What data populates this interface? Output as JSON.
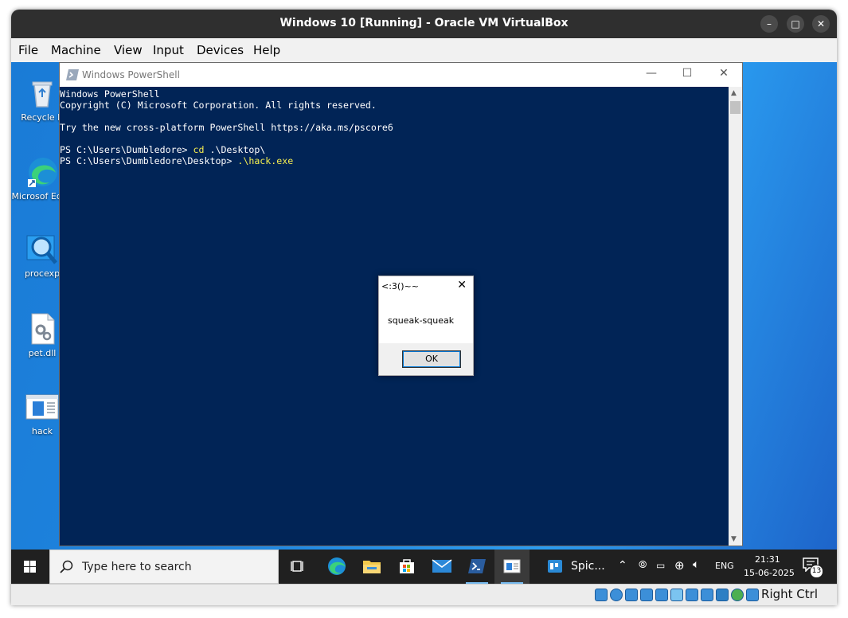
{
  "host_window": {
    "title": "Windows 10 [Running] - Oracle VM VirtualBox",
    "controls": {
      "minimize": "–",
      "maximize": "□",
      "close": "✕"
    },
    "menu": [
      "File",
      "Machine",
      "View",
      "Input",
      "Devices",
      "Help"
    ]
  },
  "desktop": {
    "icons": [
      {
        "label": "Recycle B",
        "icon": "recycle-bin-icon"
      },
      {
        "label": "Microsof Edge",
        "icon": "edge-icon"
      },
      {
        "label": "procexp",
        "icon": "process-explorer-icon"
      },
      {
        "label": "pet.dll",
        "icon": "dll-file-icon"
      },
      {
        "label": "hack",
        "icon": "exe-window-icon"
      }
    ]
  },
  "powershell": {
    "title": "Windows PowerShell",
    "controls": {
      "minimize": "—",
      "maximize": "☐",
      "close": "✕"
    },
    "lines": [
      {
        "text": "Windows PowerShell"
      },
      {
        "text": "Copyright (C) Microsoft Corporation. All rights reserved."
      },
      {
        "text": ""
      },
      {
        "text": "Try the new cross-platform PowerShell https://aka.ms/pscore6"
      },
      {
        "text": ""
      },
      {
        "prompt": "PS C:\\Users\\Dumbledore> ",
        "cmd": "cd",
        "args": " .\\Desktop\\"
      },
      {
        "prompt": "PS C:\\Users\\Dumbledore\\Desktop> ",
        "cmd": ".\\hack.exe",
        "args": ""
      }
    ]
  },
  "messagebox": {
    "title": "<:3()~~",
    "close": "✕",
    "text": "squeak-squeak",
    "ok_label": "OK"
  },
  "taskbar": {
    "search_placeholder": "Type here to search",
    "apps": [
      {
        "name": "task-view",
        "icon": "task-view-icon"
      },
      {
        "name": "edge",
        "icon": "edge-icon"
      },
      {
        "name": "file-explorer",
        "icon": "folder-icon"
      },
      {
        "name": "store",
        "icon": "store-icon"
      },
      {
        "name": "mail",
        "icon": "mail-icon"
      },
      {
        "name": "powershell",
        "icon": "powershell-icon"
      },
      {
        "name": "hack",
        "icon": "exe-window-icon"
      }
    ],
    "spice_label": "Spic...",
    "lang": "ENG",
    "time": "21:31",
    "date": "15-06-2025",
    "notification_count": "13"
  },
  "statusbar": {
    "host_key": "Right Ctrl"
  },
  "colors": {
    "ps_background": "#012456",
    "ps_command": "#f5f04f",
    "desktop_blue": "#1f86e0",
    "taskbar": "#202020"
  }
}
